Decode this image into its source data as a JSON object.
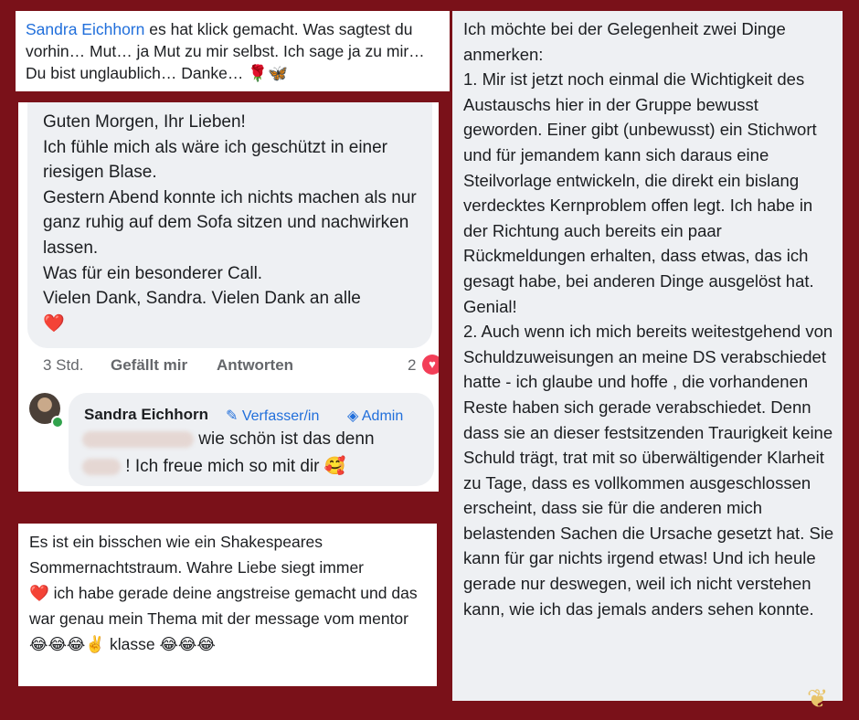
{
  "post1": {
    "author": "Sandra Eichhorn",
    "text": " es hat klick gemacht. Was sagtest du vorhin… Mut… ja Mut zu mir selbst. Ich sage ja zu mir… Du bist unglaublich… Danke…",
    "emojis": "🌹🦋"
  },
  "post2": {
    "lines": [
      "Guten Morgen, Ihr Lieben!",
      "Ich fühle mich als wäre ich geschützt in einer riesigen Blase.",
      "Gestern Abend konnte ich nichts machen als nur ganz ruhig auf dem Sofa sitzen und nachwirken lassen.",
      "Was für ein besonderer Call.",
      "Vielen Dank, Sandra. Vielen Dank an alle"
    ],
    "heart": "❤️",
    "time": "3 Std.",
    "like_label": "Gefällt mir",
    "reply_label": "Antworten",
    "reaction_count": "2",
    "reply": {
      "author": "Sandra Eichhorn",
      "badge_author": "Verfasser/in",
      "badge_admin": "Admin",
      "line1": "wie schön ist das denn",
      "line2": "! Ich freue mich so mit dir",
      "emoji": "🥰"
    }
  },
  "post3": {
    "text1": "Es ist ein bisschen wie ein Shakespeares Sommernachtstraum. Wahre Liebe siegt immer",
    "heart": "❤️",
    "text2": " ich habe gerade deine angstreise gemacht und das war genau mein Thema mit der message vom mentor ",
    "emojis1": "😂😂😂✌️",
    "text3": " klasse ",
    "emojis2": "😂😂😂"
  },
  "post4": {
    "text": "Ich möchte bei der Gelegenheit zwei Dinge anmerken:\n1. Mir ist jetzt noch einmal die Wichtigkeit des Austauschs hier in der Gruppe bewusst geworden. Einer gibt (unbewusst) ein Stichwort und für jemandem kann sich daraus eine Steilvorlage entwickeln, die direkt ein bislang verdecktes Kernproblem offen legt. Ich habe in der Richtung auch bereits ein paar Rückmeldungen erhalten, dass etwas, das ich gesagt habe, bei anderen Dinge ausgelöst hat. Genial!\n2. Auch wenn ich mich bereits weitestgehend von Schuldzuweisungen an meine DS verabschiedet hatte - ich glaube und hoffe , die vorhandenen Reste haben sich gerade verabschiedet. Denn dass sie an dieser festsitzenden Traurigkeit keine Schuld trägt, trat mit so überwältigender Klarheit zu Tage, dass es vollkommen ausgeschlossen erscheint, dass sie für die anderen mich belastenden Sachen die Ursache gesetzt hat. Sie kann für gar nichts irgend etwas! Und ich heule gerade nur deswegen, weil ich nicht verstehen kann, wie ich das jemals anders sehen konnte."
  },
  "colors": {
    "background": "#7a1119",
    "link": "#216fdb",
    "bubble": "#eef0f3"
  }
}
